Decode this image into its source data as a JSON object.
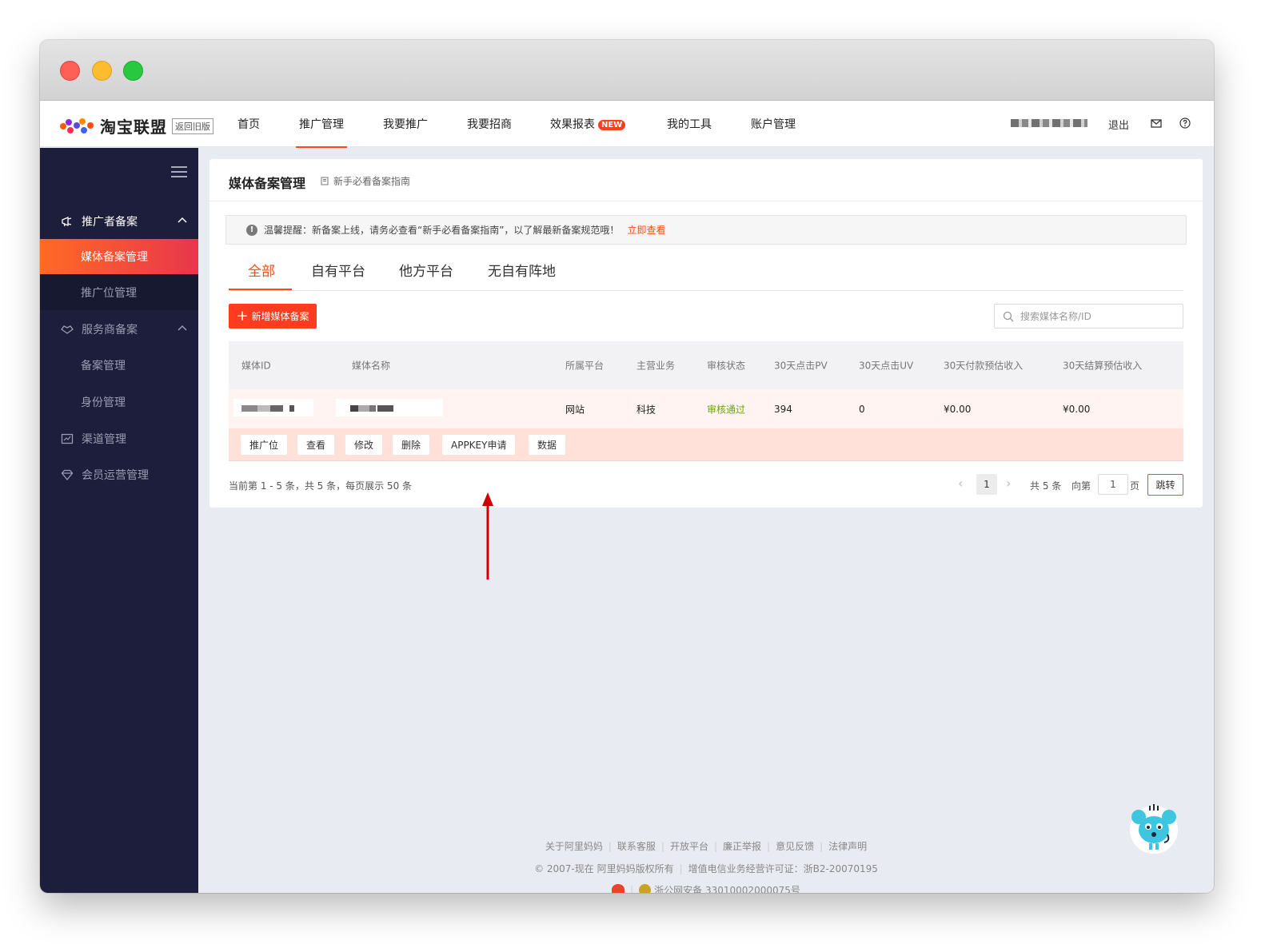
{
  "brand": {
    "name": "淘宝联盟",
    "return_old": "返回旧版"
  },
  "topnav": {
    "items": [
      "首页",
      "推广管理",
      "我要推广",
      "我要招商",
      "效果报表",
      "我的工具",
      "账户管理"
    ],
    "active_index": 1,
    "new_badge": "NEW",
    "logout": "退出"
  },
  "sidebar": {
    "groups": [
      {
        "label": "推广者备案",
        "icon": "megaphone-icon",
        "expanded": true,
        "items": [
          "媒体备案管理",
          "推广位管理"
        ]
      },
      {
        "label": "服务商备案",
        "icon": "handshake-icon",
        "expanded": true,
        "items": [
          "备案管理",
          "身份管理"
        ]
      },
      {
        "label": "渠道管理",
        "icon": "channel-icon"
      },
      {
        "label": "会员运营管理",
        "icon": "diamond-icon"
      }
    ],
    "active_item": "媒体备案管理"
  },
  "page": {
    "title": "媒体备案管理",
    "guide_link": "新手必看备案指南",
    "notice_text": "温馨提醒：新备案上线，请务必查看“新手必看备案指南”，以了解最新备案规范哦！",
    "notice_link": "立即查看",
    "tabs": [
      "全部",
      "自有平台",
      "他方平台",
      "无自有阵地"
    ],
    "active_tab": 0,
    "add_button": "新增媒体备案",
    "search_placeholder": "搜索媒体名称/ID"
  },
  "table": {
    "headers": [
      "媒体ID",
      "媒体名称",
      "所属平台",
      "主营业务",
      "审核状态",
      "30天点击PV",
      "30天点击UV",
      "30天付款预估收入",
      "30天结算预估收入"
    ],
    "row": {
      "platform": "网站",
      "business": "科技",
      "status": "审核通过",
      "pv": "394",
      "uv": "0",
      "pay_income": "¥0.00",
      "settle_income": "¥0.00"
    },
    "actions": [
      "推广位",
      "查看",
      "修改",
      "删除",
      "APPKEY申请",
      "数据"
    ]
  },
  "pagination": {
    "info": "当前第 1 - 5 条，共 5 条，每页展示 50 条",
    "current": "1",
    "total": "共 5 条",
    "goto_prefix": "向第",
    "goto_value": "1",
    "goto_suffix": "页",
    "jump": "跳转"
  },
  "footer": {
    "links": [
      "关于阿里妈妈",
      "联系客服",
      "开放平台",
      "廉正举报",
      "意见反馈",
      "法律声明"
    ],
    "copyright": "© 2007-现在 阿里妈妈版权所有",
    "license": "增值电信业务经营许可证：浙B2-20070195",
    "police": "浙公网安备 33010002000075号"
  },
  "colors": {
    "accent": "#ff4a12",
    "sidebar_bg": "#1c1e3b",
    "status_ok": "#67a612",
    "annotation_arrow": "#cc0000"
  }
}
